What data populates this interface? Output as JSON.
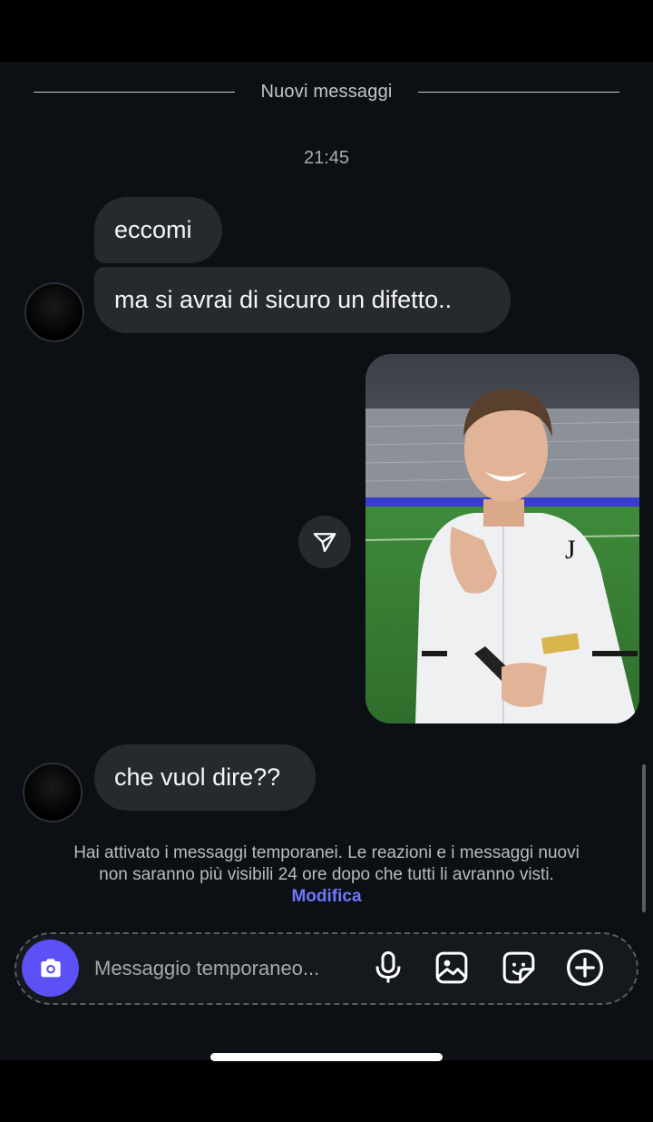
{
  "thread": {
    "divider_label": "Nuovi messaggi",
    "timestamp": "21:45",
    "messages": [
      {
        "from": "other",
        "text": "eccomi"
      },
      {
        "from": "other",
        "text": "ma si avrai di sicuro un difetto.."
      },
      {
        "from": "other",
        "text": "che vuol dire??"
      }
    ],
    "shared_photo": {
      "icon": "share-icon"
    }
  },
  "notice": {
    "text": "Hai attivato i messaggi temporanei. Le reazioni e i messaggi nuovi non saranno più visibili 24 ore dopo che tutti li avranno visti.",
    "link": "Modifica"
  },
  "composer": {
    "placeholder": "Messaggio temporaneo...",
    "camera_color": "#5b51f6",
    "icons": [
      "camera-icon",
      "microphone-icon",
      "gallery-icon",
      "sticker-icon",
      "plus-icon"
    ]
  },
  "colors": {
    "background": "#0c1014",
    "bubble": "#262a2f",
    "accent": "#6f78ff"
  }
}
